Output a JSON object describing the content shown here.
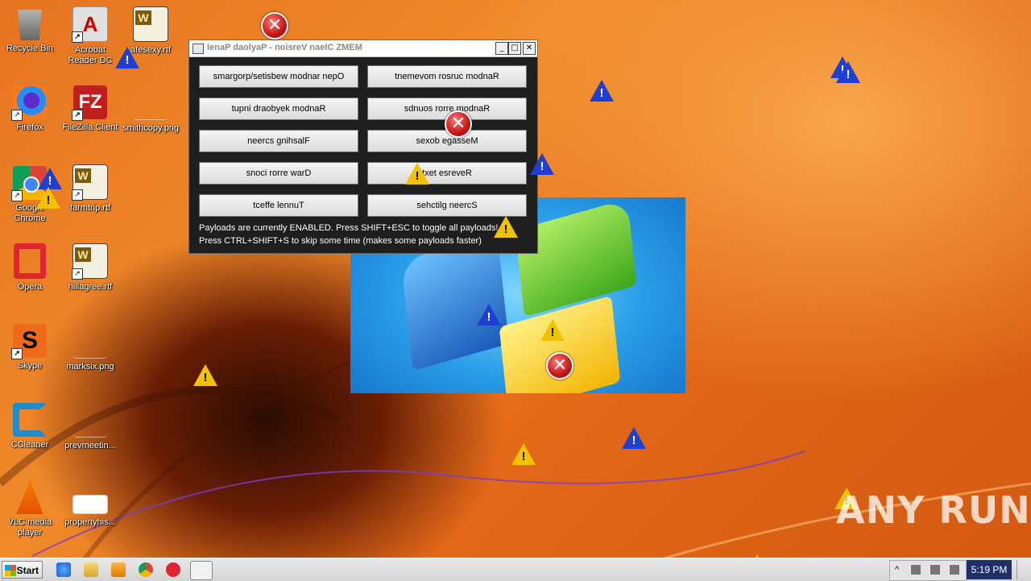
{
  "desktop_icons": [
    {
      "id": "recycle",
      "label": "Recycle Bin"
    },
    {
      "id": "acrobat",
      "label": "Acrobat Reader DC"
    },
    {
      "id": "safesexy",
      "label": "afesexy.rtf"
    },
    {
      "id": "firefox",
      "label": "Firefox"
    },
    {
      "id": "filezilla",
      "label": "FileZilla Client"
    },
    {
      "id": "smithcopy",
      "label": "smithcopy.png"
    },
    {
      "id": "chrome",
      "label": "Google Chrome"
    },
    {
      "id": "farmtrip",
      "label": "farmtrip.rtf"
    },
    {
      "id": "opera",
      "label": "Opera"
    },
    {
      "id": "hillagree",
      "label": "hillagree.rtf"
    },
    {
      "id": "skype",
      "label": "Skype"
    },
    {
      "id": "marksix",
      "label": "marksix.png"
    },
    {
      "id": "ccleaner",
      "label": "CCleaner"
    },
    {
      "id": "prevmeetin",
      "label": "prevmeetin..."
    },
    {
      "id": "vlc",
      "label": "VLC media player"
    },
    {
      "id": "propertyhis",
      "label": "propertyhis..."
    }
  ],
  "window": {
    "title": "lenaP daolyaP - noisreV naelC ZMEM",
    "buttons": {
      "open_random_websites": "smargorp/setisbew modnar nepO",
      "random_cursor_movement": "tnemevom rosruc modnaR",
      "random_keyboard_input": "tupni draobyek modnaR",
      "random_error_sounds": "sdnuos rorre modnaR",
      "flashing_screen": "neercs gnihsalF",
      "message_boxes": "sexob egasseM",
      "draw_error_icons": "snoci rorre warD",
      "reverse_text": "txet esreveR",
      "tunnel_effect": "tceffe lennuT",
      "screen_glitches": "sehctilg neercS"
    },
    "status_line_1": "Payloads are currently ENABLED. Press SHIFT+ESC to toggle all payloads!",
    "status_line_2": "Press CTRL+SHIFT+S to skip some time (makes some payloads faster)"
  },
  "taskbar": {
    "start_label": "Start",
    "clock": "5:19 PM"
  },
  "watermark": "ANY RUN",
  "colors": {
    "desktop_orange": "#e67421",
    "window_body": "#1e1e1e",
    "error_red": "#c41616",
    "warning_yellow": "#f2c200",
    "info_blue": "#1f3fd0"
  }
}
